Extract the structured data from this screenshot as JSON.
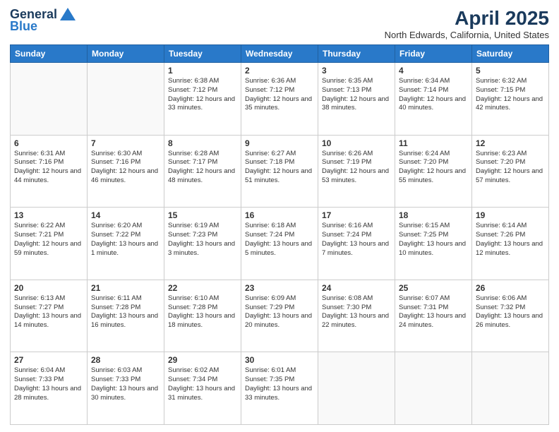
{
  "logo": {
    "line1": "General",
    "line2": "Blue"
  },
  "title": "April 2025",
  "subtitle": "North Edwards, California, United States",
  "days_of_week": [
    "Sunday",
    "Monday",
    "Tuesday",
    "Wednesday",
    "Thursday",
    "Friday",
    "Saturday"
  ],
  "weeks": [
    [
      {
        "day": "",
        "sunrise": "",
        "sunset": "",
        "daylight": ""
      },
      {
        "day": "",
        "sunrise": "",
        "sunset": "",
        "daylight": ""
      },
      {
        "day": "1",
        "sunrise": "Sunrise: 6:38 AM",
        "sunset": "Sunset: 7:12 PM",
        "daylight": "Daylight: 12 hours and 33 minutes."
      },
      {
        "day": "2",
        "sunrise": "Sunrise: 6:36 AM",
        "sunset": "Sunset: 7:12 PM",
        "daylight": "Daylight: 12 hours and 35 minutes."
      },
      {
        "day": "3",
        "sunrise": "Sunrise: 6:35 AM",
        "sunset": "Sunset: 7:13 PM",
        "daylight": "Daylight: 12 hours and 38 minutes."
      },
      {
        "day": "4",
        "sunrise": "Sunrise: 6:34 AM",
        "sunset": "Sunset: 7:14 PM",
        "daylight": "Daylight: 12 hours and 40 minutes."
      },
      {
        "day": "5",
        "sunrise": "Sunrise: 6:32 AM",
        "sunset": "Sunset: 7:15 PM",
        "daylight": "Daylight: 12 hours and 42 minutes."
      }
    ],
    [
      {
        "day": "6",
        "sunrise": "Sunrise: 6:31 AM",
        "sunset": "Sunset: 7:16 PM",
        "daylight": "Daylight: 12 hours and 44 minutes."
      },
      {
        "day": "7",
        "sunrise": "Sunrise: 6:30 AM",
        "sunset": "Sunset: 7:16 PM",
        "daylight": "Daylight: 12 hours and 46 minutes."
      },
      {
        "day": "8",
        "sunrise": "Sunrise: 6:28 AM",
        "sunset": "Sunset: 7:17 PM",
        "daylight": "Daylight: 12 hours and 48 minutes."
      },
      {
        "day": "9",
        "sunrise": "Sunrise: 6:27 AM",
        "sunset": "Sunset: 7:18 PM",
        "daylight": "Daylight: 12 hours and 51 minutes."
      },
      {
        "day": "10",
        "sunrise": "Sunrise: 6:26 AM",
        "sunset": "Sunset: 7:19 PM",
        "daylight": "Daylight: 12 hours and 53 minutes."
      },
      {
        "day": "11",
        "sunrise": "Sunrise: 6:24 AM",
        "sunset": "Sunset: 7:20 PM",
        "daylight": "Daylight: 12 hours and 55 minutes."
      },
      {
        "day": "12",
        "sunrise": "Sunrise: 6:23 AM",
        "sunset": "Sunset: 7:20 PM",
        "daylight": "Daylight: 12 hours and 57 minutes."
      }
    ],
    [
      {
        "day": "13",
        "sunrise": "Sunrise: 6:22 AM",
        "sunset": "Sunset: 7:21 PM",
        "daylight": "Daylight: 12 hours and 59 minutes."
      },
      {
        "day": "14",
        "sunrise": "Sunrise: 6:20 AM",
        "sunset": "Sunset: 7:22 PM",
        "daylight": "Daylight: 13 hours and 1 minute."
      },
      {
        "day": "15",
        "sunrise": "Sunrise: 6:19 AM",
        "sunset": "Sunset: 7:23 PM",
        "daylight": "Daylight: 13 hours and 3 minutes."
      },
      {
        "day": "16",
        "sunrise": "Sunrise: 6:18 AM",
        "sunset": "Sunset: 7:24 PM",
        "daylight": "Daylight: 13 hours and 5 minutes."
      },
      {
        "day": "17",
        "sunrise": "Sunrise: 6:16 AM",
        "sunset": "Sunset: 7:24 PM",
        "daylight": "Daylight: 13 hours and 7 minutes."
      },
      {
        "day": "18",
        "sunrise": "Sunrise: 6:15 AM",
        "sunset": "Sunset: 7:25 PM",
        "daylight": "Daylight: 13 hours and 10 minutes."
      },
      {
        "day": "19",
        "sunrise": "Sunrise: 6:14 AM",
        "sunset": "Sunset: 7:26 PM",
        "daylight": "Daylight: 13 hours and 12 minutes."
      }
    ],
    [
      {
        "day": "20",
        "sunrise": "Sunrise: 6:13 AM",
        "sunset": "Sunset: 7:27 PM",
        "daylight": "Daylight: 13 hours and 14 minutes."
      },
      {
        "day": "21",
        "sunrise": "Sunrise: 6:11 AM",
        "sunset": "Sunset: 7:28 PM",
        "daylight": "Daylight: 13 hours and 16 minutes."
      },
      {
        "day": "22",
        "sunrise": "Sunrise: 6:10 AM",
        "sunset": "Sunset: 7:28 PM",
        "daylight": "Daylight: 13 hours and 18 minutes."
      },
      {
        "day": "23",
        "sunrise": "Sunrise: 6:09 AM",
        "sunset": "Sunset: 7:29 PM",
        "daylight": "Daylight: 13 hours and 20 minutes."
      },
      {
        "day": "24",
        "sunrise": "Sunrise: 6:08 AM",
        "sunset": "Sunset: 7:30 PM",
        "daylight": "Daylight: 13 hours and 22 minutes."
      },
      {
        "day": "25",
        "sunrise": "Sunrise: 6:07 AM",
        "sunset": "Sunset: 7:31 PM",
        "daylight": "Daylight: 13 hours and 24 minutes."
      },
      {
        "day": "26",
        "sunrise": "Sunrise: 6:06 AM",
        "sunset": "Sunset: 7:32 PM",
        "daylight": "Daylight: 13 hours and 26 minutes."
      }
    ],
    [
      {
        "day": "27",
        "sunrise": "Sunrise: 6:04 AM",
        "sunset": "Sunset: 7:33 PM",
        "daylight": "Daylight: 13 hours and 28 minutes."
      },
      {
        "day": "28",
        "sunrise": "Sunrise: 6:03 AM",
        "sunset": "Sunset: 7:33 PM",
        "daylight": "Daylight: 13 hours and 30 minutes."
      },
      {
        "day": "29",
        "sunrise": "Sunrise: 6:02 AM",
        "sunset": "Sunset: 7:34 PM",
        "daylight": "Daylight: 13 hours and 31 minutes."
      },
      {
        "day": "30",
        "sunrise": "Sunrise: 6:01 AM",
        "sunset": "Sunset: 7:35 PM",
        "daylight": "Daylight: 13 hours and 33 minutes."
      },
      {
        "day": "",
        "sunrise": "",
        "sunset": "",
        "daylight": ""
      },
      {
        "day": "",
        "sunrise": "",
        "sunset": "",
        "daylight": ""
      },
      {
        "day": "",
        "sunrise": "",
        "sunset": "",
        "daylight": ""
      }
    ]
  ]
}
